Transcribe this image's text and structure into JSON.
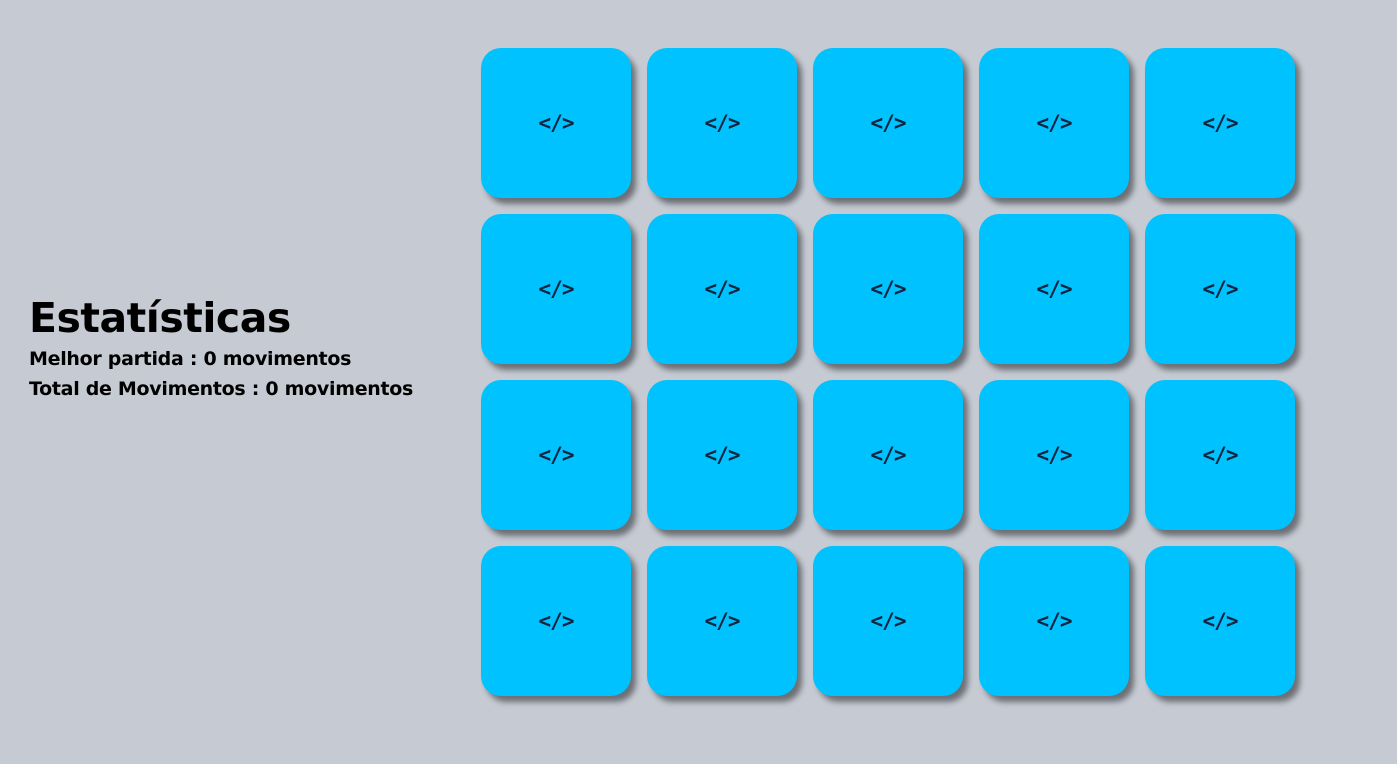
{
  "stats": {
    "title": "Estatísticas",
    "best_match_label": "Melhor partida",
    "best_match_value": "0 movimentos",
    "total_moves_label": "Total de Movimentos",
    "total_moves_value": "0 movimentos",
    "separator": ":"
  },
  "board": {
    "rows": 4,
    "columns": 5,
    "card_color": "#00c2ff",
    "background_color": "#c5cad3",
    "card_icon_name": "code-icon",
    "cards": [
      {
        "face": "</>",
        "icon": "code-icon"
      },
      {
        "face": "</>",
        "icon": "code-icon"
      },
      {
        "face": "</>",
        "icon": "code-icon"
      },
      {
        "face": "</>",
        "icon": "code-icon"
      },
      {
        "face": "</>",
        "icon": "code-icon"
      },
      {
        "face": "</>",
        "icon": "code-icon"
      },
      {
        "face": "</>",
        "icon": "code-icon"
      },
      {
        "face": "</>",
        "icon": "code-icon"
      },
      {
        "face": "</>",
        "icon": "code-icon"
      },
      {
        "face": "</>",
        "icon": "code-icon"
      },
      {
        "face": "</>",
        "icon": "code-icon"
      },
      {
        "face": "</>",
        "icon": "code-icon"
      },
      {
        "face": "</>",
        "icon": "code-icon"
      },
      {
        "face": "</>",
        "icon": "code-icon"
      },
      {
        "face": "</>",
        "icon": "code-icon"
      },
      {
        "face": "</>",
        "icon": "code-icon"
      },
      {
        "face": "</>",
        "icon": "code-icon"
      },
      {
        "face": "</>",
        "icon": "code-icon"
      },
      {
        "face": "</>",
        "icon": "code-icon"
      },
      {
        "face": "</>",
        "icon": "code-icon"
      }
    ]
  }
}
